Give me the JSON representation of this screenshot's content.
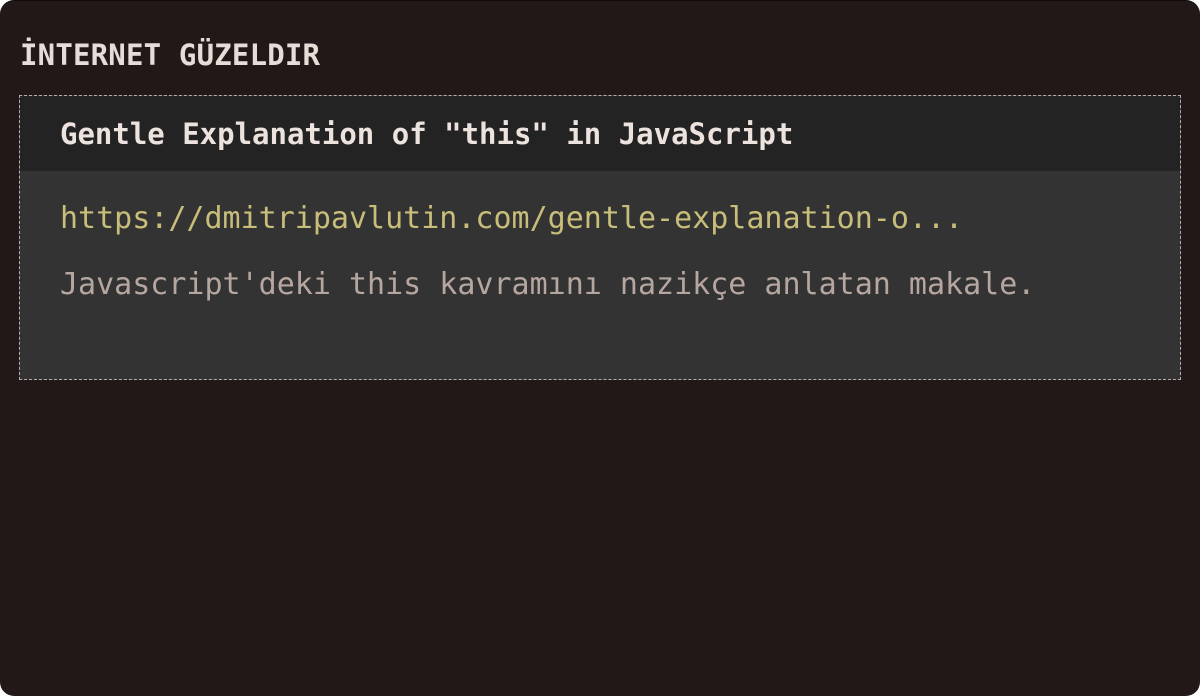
{
  "section": {
    "title": "İNTERNET GÜZELDIR"
  },
  "card": {
    "title": "Gentle Explanation of \"this\" in JavaScript",
    "url": "https://dmitripavlutin.com/gentle-explanation-o...",
    "description": "Javascript'deki this kavramını nazikçe anlatan makale."
  },
  "colors": {
    "background": "#221817",
    "card_header": "#232323",
    "card_body": "#333333",
    "title_text": "#e6dcd8",
    "url_text": "#c8be7a",
    "description_text": "#b6a6a0",
    "card_border": "#b9aca8"
  }
}
